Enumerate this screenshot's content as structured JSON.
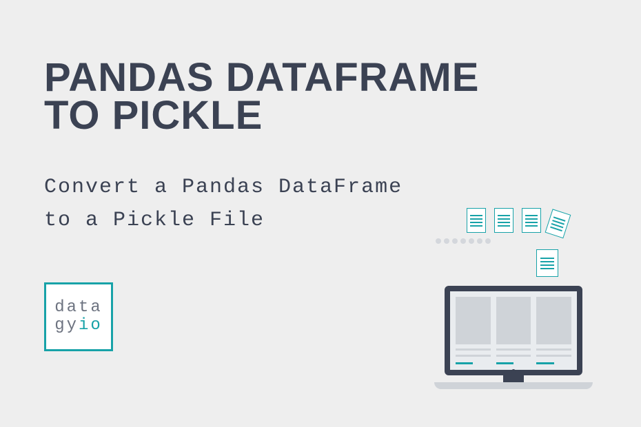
{
  "title_line1": "PANDAS DATAFRAME",
  "title_line2": "TO PICKLE",
  "subtitle_line1": "Convert a Pandas DataFrame",
  "subtitle_line2": "to a Pickle File",
  "logo": {
    "line1": "data",
    "line2_part1": "gy",
    "line2_part2": "io"
  }
}
